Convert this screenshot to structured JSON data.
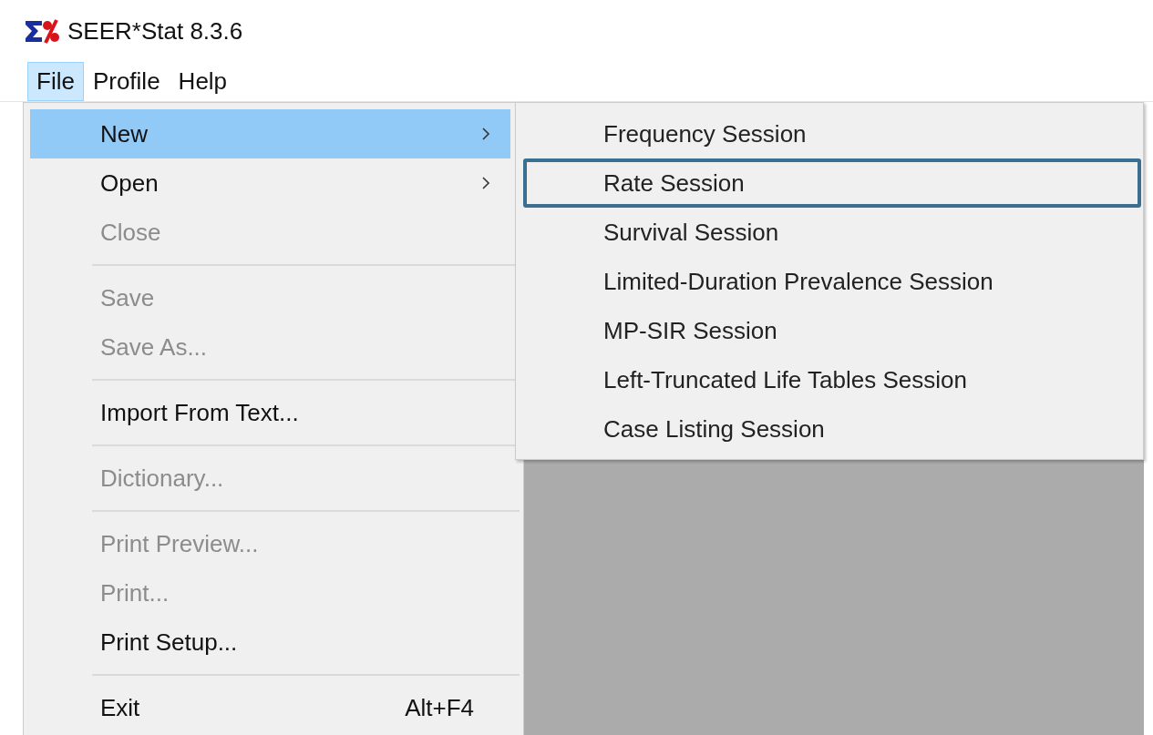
{
  "window": {
    "title": "SEER*Stat 8.3.6"
  },
  "menu_bar": [
    {
      "label": "File",
      "selected": true
    },
    {
      "label": "Profile",
      "selected": false
    },
    {
      "label": "Help",
      "selected": false
    }
  ],
  "file_menu": [
    {
      "kind": "item",
      "label": "New",
      "disabled": false,
      "highlighted": true,
      "has_submenu": true
    },
    {
      "kind": "item",
      "label": "Open",
      "disabled": false,
      "highlighted": false,
      "has_submenu": true
    },
    {
      "kind": "item",
      "label": "Close",
      "disabled": true,
      "highlighted": false,
      "has_submenu": false
    },
    {
      "kind": "separator"
    },
    {
      "kind": "item",
      "label": "Save",
      "disabled": true,
      "highlighted": false,
      "has_submenu": false
    },
    {
      "kind": "item",
      "label": "Save As...",
      "disabled": true,
      "highlighted": false,
      "has_submenu": false
    },
    {
      "kind": "separator"
    },
    {
      "kind": "item",
      "label": "Import From Text...",
      "disabled": false,
      "highlighted": false,
      "has_submenu": false
    },
    {
      "kind": "separator"
    },
    {
      "kind": "item",
      "label": "Dictionary...",
      "disabled": true,
      "highlighted": false,
      "has_submenu": false
    },
    {
      "kind": "separator"
    },
    {
      "kind": "item",
      "label": "Print Preview...",
      "disabled": true,
      "highlighted": false,
      "has_submenu": false
    },
    {
      "kind": "item",
      "label": "Print...",
      "disabled": true,
      "highlighted": false,
      "has_submenu": false
    },
    {
      "kind": "item",
      "label": "Print Setup...",
      "disabled": false,
      "highlighted": false,
      "has_submenu": false
    },
    {
      "kind": "separator"
    },
    {
      "kind": "item",
      "label": "Exit",
      "shortcut": "Alt+F4",
      "disabled": false,
      "highlighted": false,
      "has_submenu": false
    }
  ],
  "new_submenu": [
    {
      "label": "Frequency Session",
      "outlined": false
    },
    {
      "label": "Rate Session",
      "outlined": true
    },
    {
      "label": "Survival Session",
      "outlined": false
    },
    {
      "label": "Limited-Duration Prevalence Session",
      "outlined": false
    },
    {
      "label": "MP-SIR Session",
      "outlined": false
    },
    {
      "label": "Left-Truncated Life Tables Session",
      "outlined": false
    },
    {
      "label": "Case Listing Session",
      "outlined": false
    }
  ]
}
